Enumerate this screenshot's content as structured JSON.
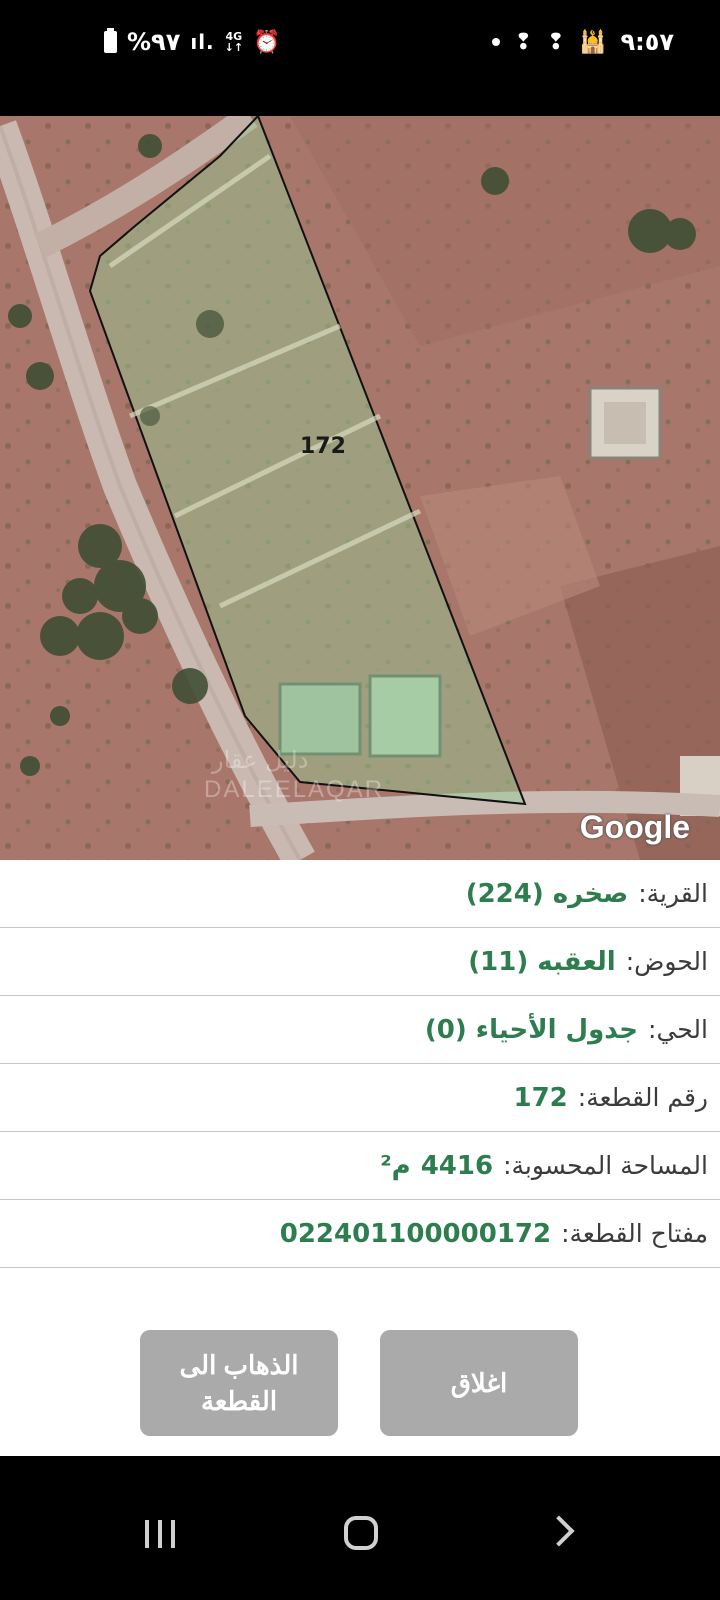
{
  "status_bar": {
    "battery_text": "%٩٧",
    "signal_text": "ıl.",
    "network_type": "4G",
    "time": "٩:٥٧",
    "icons": [
      "battery-icon",
      "signal-icon",
      "network-4g-icon",
      "alarm-icon",
      "dot-icon",
      "notification-icon",
      "notification-icon",
      "mosque-icon"
    ]
  },
  "map": {
    "parcel_label": "172",
    "attribution": "Google",
    "watermark": "DALEELAQAR",
    "watermark_ar": "دليل عقار"
  },
  "parcel_info": {
    "village_label": "القرية:",
    "village_value": "صخره (224)",
    "basin_label": "الحوض:",
    "basin_value": "العقبه (11)",
    "district_label": "الحي:",
    "district_value": "جدول الأحياء (0)",
    "parcel_no_label": "رقم القطعة:",
    "parcel_no_value": "172",
    "area_label": "المساحة المحسوبة:",
    "area_value": "4416",
    "area_unit": "م²",
    "key_label": "مفتاح القطعة:",
    "key_value": "022401100000172"
  },
  "buttons": {
    "close_label": "اغلاق",
    "go_label": "الذهاب الى القطعة"
  },
  "colors": {
    "value_green": "#2e7d4f",
    "button_gray": "#aaaaaa",
    "parcel_fill": "rgba(150,205,150,0.45)"
  }
}
